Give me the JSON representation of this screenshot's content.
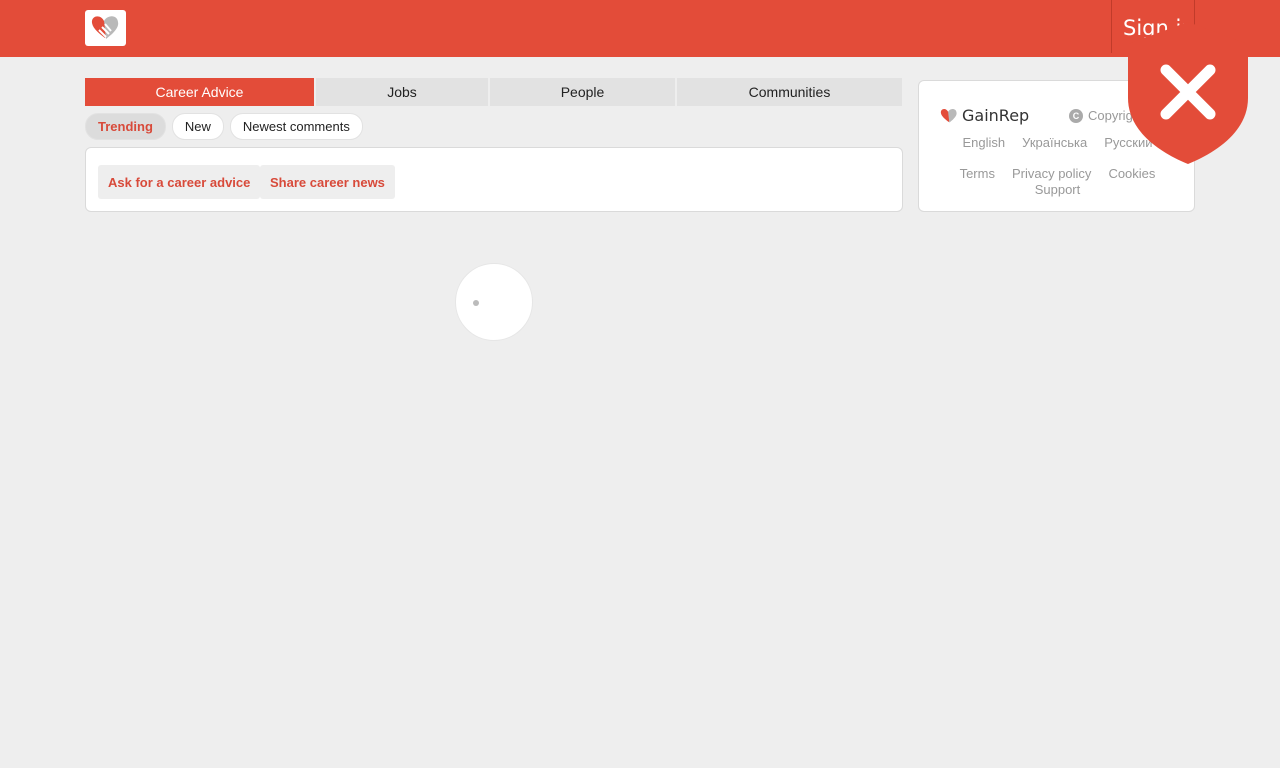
{
  "header": {
    "signin_label": "Sign in"
  },
  "tabs": [
    {
      "label": "Career Advice",
      "active": true
    },
    {
      "label": "Jobs"
    },
    {
      "label": "People"
    },
    {
      "label": "Communities"
    }
  ],
  "filters": [
    {
      "label": "Trending",
      "active": true
    },
    {
      "label": "New"
    },
    {
      "label": "Newest comments"
    }
  ],
  "actions": {
    "ask": "Ask for a career advice",
    "share": "Share career news"
  },
  "sidebar": {
    "brand": "GainRep",
    "copyright": "Copyright",
    "languages": [
      "English",
      "Українська",
      "Русский"
    ],
    "links": [
      "Terms",
      "Privacy policy",
      "Cookies"
    ],
    "support": "Support"
  },
  "icons": {
    "logo": "handshake-heart-icon",
    "copyright": "copyright-icon",
    "shield": "shield-close-icon"
  },
  "colors": {
    "brand": "#e34c39",
    "accent_text": "#d84a3a"
  }
}
